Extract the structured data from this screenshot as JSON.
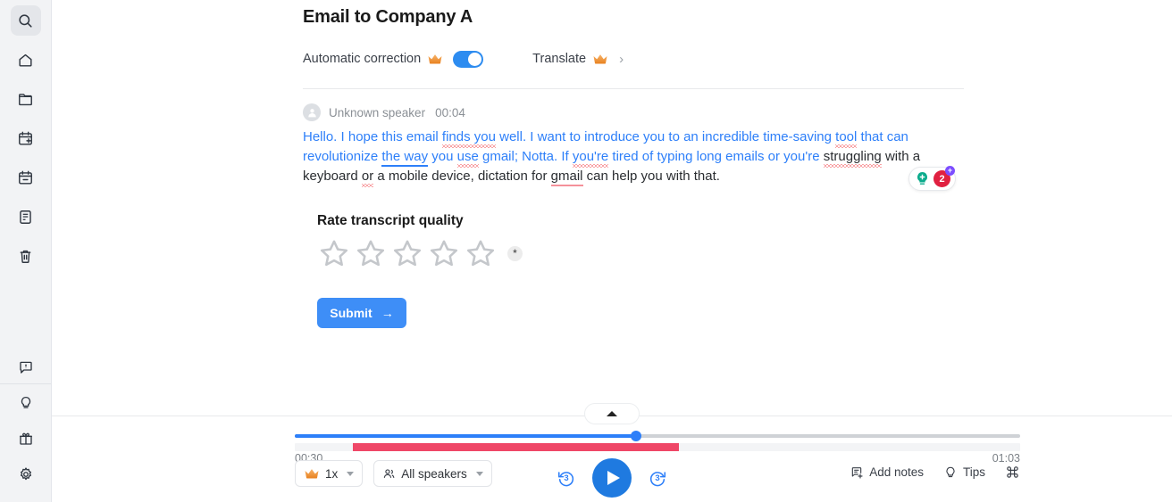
{
  "sidebar": {
    "top_items": [
      {
        "name": "search-icon",
        "label": "Search",
        "active": true
      },
      {
        "name": "home-icon",
        "label": "Home",
        "active": false
      },
      {
        "name": "folder-icon",
        "label": "Folders",
        "active": false
      },
      {
        "name": "calendar-add-icon",
        "label": "New meeting",
        "active": false
      },
      {
        "name": "calendar-icon",
        "label": "Calendar",
        "active": false
      },
      {
        "name": "notes-icon",
        "label": "Notes",
        "active": false
      },
      {
        "name": "trash-icon",
        "label": "Trash",
        "active": false
      }
    ],
    "bottom_items": [
      {
        "name": "feedback-icon",
        "label": "Feedback"
      },
      {
        "name": "lightbulb-icon",
        "label": "Tips"
      },
      {
        "name": "gift-icon",
        "label": "Gift"
      },
      {
        "name": "settings-gear-icon",
        "label": "Settings"
      }
    ]
  },
  "header": {
    "title": "Email to Company A",
    "auto_correction_label": "Automatic correction",
    "auto_correction_on": true,
    "translate_label": "Translate",
    "chevron": "›"
  },
  "transcript": {
    "speaker": "Unknown speaker",
    "timestamp": "00:04",
    "segments": [
      {
        "text": "Hello. I hope this email ",
        "color": "blue"
      },
      {
        "text": "finds you",
        "color": "blue",
        "mark": "squiggle-red"
      },
      {
        "text": " well. I want to introduce you to an incredible time-saving ",
        "color": "blue"
      },
      {
        "text": "tool",
        "color": "blue",
        "mark": "squiggle-red"
      },
      {
        "text": " that can revolutionize ",
        "color": "blue"
      },
      {
        "text": "the way",
        "color": "blue",
        "mark": "underline-blue"
      },
      {
        "text": " you ",
        "color": "blue"
      },
      {
        "text": "use",
        "color": "blue",
        "mark": "squiggle-red"
      },
      {
        "text": " gmail; Notta. If ",
        "color": "blue"
      },
      {
        "text": "you're",
        "color": "blue",
        "mark": "squiggle-red"
      },
      {
        "text": " tired of typing long emails or you're ",
        "color": "blue"
      },
      {
        "text": "struggling",
        "color": "black",
        "mark": "squiggle-red"
      },
      {
        "text": " with a keyboard ",
        "color": "black"
      },
      {
        "text": "or",
        "color": "black",
        "mark": "squiggle-red"
      },
      {
        "text": " a mobile device, dictation for ",
        "color": "black"
      },
      {
        "text": "gmail",
        "color": "black",
        "mark": "underline-pink"
      },
      {
        "text": " can help you with that.",
        "color": "black"
      }
    ],
    "grammar_badge": {
      "bulb_icon": "lightbulb-plus-icon",
      "count": "2",
      "plus": "+"
    }
  },
  "rating": {
    "title": "Rate transcript quality",
    "stars_total": 5,
    "stars_selected": 0,
    "asterisk": "*",
    "submit_label": "Submit",
    "submit_arrow": "→",
    "submit_color": "#3e8ef7"
  },
  "player": {
    "current_time": "00:30",
    "total_time": "01:03",
    "progress_percent": 47,
    "segment_start_percent": 8,
    "segment_end_percent": 53,
    "speed_label": "1x",
    "speakers_label": "All speakers",
    "rewind_seconds": "3",
    "forward_seconds": "3",
    "add_notes_label": "Add notes",
    "tips_label": "Tips",
    "shortcut_icon": "command-key-icon",
    "accent_color": "#2d7ff9",
    "segment_color": "#ef4767"
  }
}
